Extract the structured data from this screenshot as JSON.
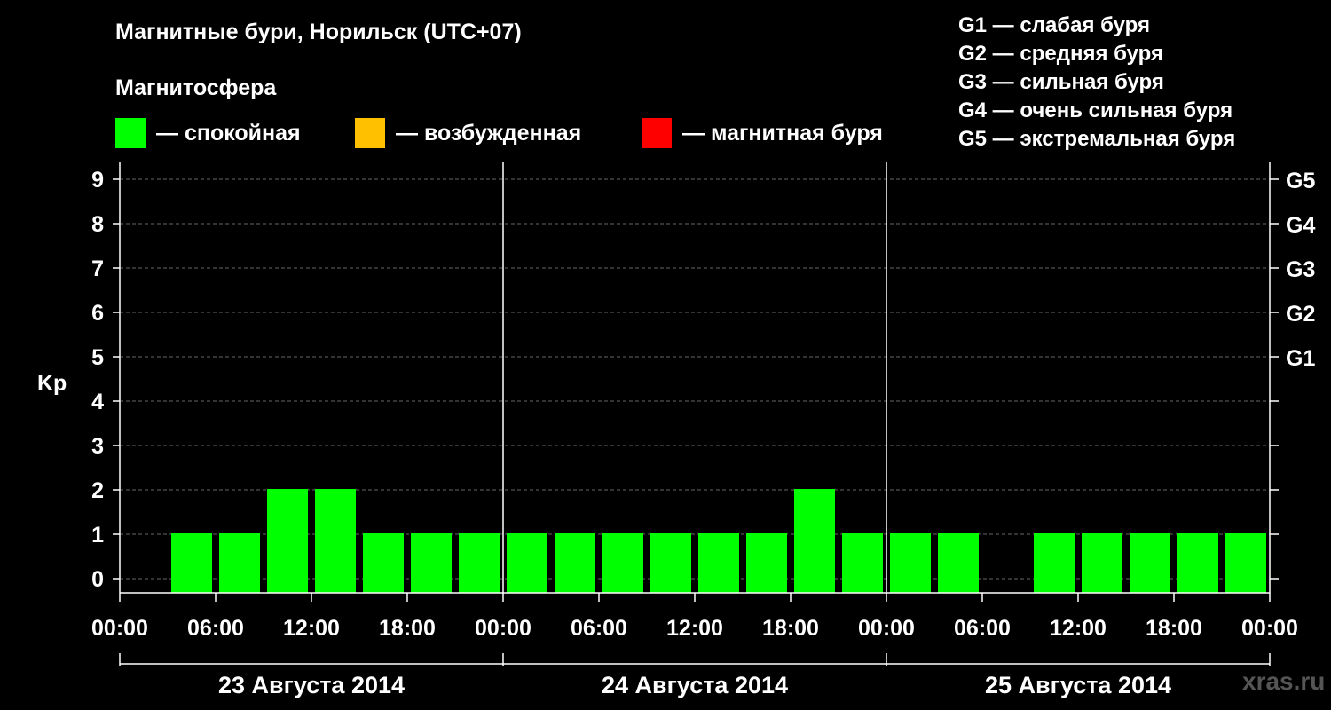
{
  "title": "Магнитные бури, Норильск (UTC+07)",
  "subtitle": "Магнитосфера",
  "legend": [
    {
      "label": "— спокойная",
      "color": "#00ff00"
    },
    {
      "label": "— возбужденная",
      "color": "#ffc000"
    },
    {
      "label": "— магнитная буря",
      "color": "#ff0000"
    }
  ],
  "g_legend": [
    "G1 — слабая буря",
    "G2 — средняя буря",
    "G3 — сильная буря",
    "G4 — очень сильная буря",
    "G5 — экстремальная буря"
  ],
  "watermark": "xras.ru",
  "chart_data": {
    "type": "bar",
    "ylabel": "Kp",
    "ylim": [
      0,
      9
    ],
    "yticks": [
      "0",
      "1",
      "2",
      "3",
      "4",
      "5",
      "6",
      "7",
      "8",
      "9"
    ],
    "right_ticks": [
      {
        "value": 5,
        "label": "G1"
      },
      {
        "value": 6,
        "label": "G2"
      },
      {
        "value": 7,
        "label": "G3"
      },
      {
        "value": 8,
        "label": "G4"
      },
      {
        "value": 9,
        "label": "G5"
      }
    ],
    "xtick_labels": [
      "00:00",
      "06:00",
      "12:00",
      "18:00",
      "00:00",
      "06:00",
      "12:00",
      "18:00",
      "00:00",
      "06:00",
      "12:00",
      "18:00",
      "00:00"
    ],
    "days": [
      "23 Августа 2014",
      "24 Августа 2014",
      "25 Августа 2014"
    ],
    "bar_interval_hours": 3,
    "values": [
      null,
      1,
      1,
      2,
      2,
      1,
      1,
      1,
      1,
      1,
      1,
      1,
      1,
      1,
      2,
      1,
      1,
      1,
      null,
      1,
      1,
      1,
      1,
      1
    ],
    "color": "#00ff00",
    "grid": "dashed horizontal at each integer"
  }
}
